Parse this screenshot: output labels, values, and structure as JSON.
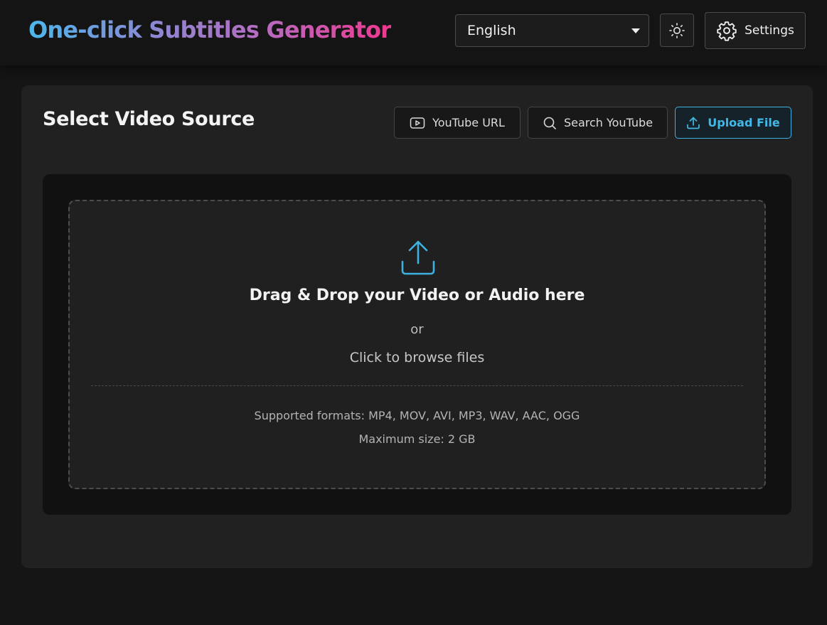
{
  "header": {
    "app_title": "One-click Subtitles Generator",
    "language": {
      "selected": "English"
    },
    "theme_toggle_icon": "sun-icon",
    "settings": {
      "label": "Settings",
      "icon": "gear-icon"
    }
  },
  "source_panel": {
    "title": "Select Video Source",
    "tabs": [
      {
        "label": "YouTube URL",
        "icon": "play-icon",
        "active": false
      },
      {
        "label": "Search YouTube",
        "icon": "search-icon",
        "active": false
      },
      {
        "label": "Upload File",
        "icon": "upload-icon",
        "active": true
      }
    ]
  },
  "dropzone": {
    "icon": "upload-icon",
    "heading": "Drag & Drop your Video or Audio here",
    "or_text": "or",
    "browse_text": "Click to browse files",
    "formats_text": "Supported formats: MP4, MOV, AVI, MP3, WAV, AAC, OGG",
    "max_size_text": "Maximum size: 2 GB"
  },
  "colors": {
    "accent": "#3db1e0",
    "title_gradient": [
      "#4cb6ec",
      "#8d88d2",
      "#b66bc0",
      "#f0388f"
    ],
    "background": "#151515",
    "panel": "#212121"
  }
}
